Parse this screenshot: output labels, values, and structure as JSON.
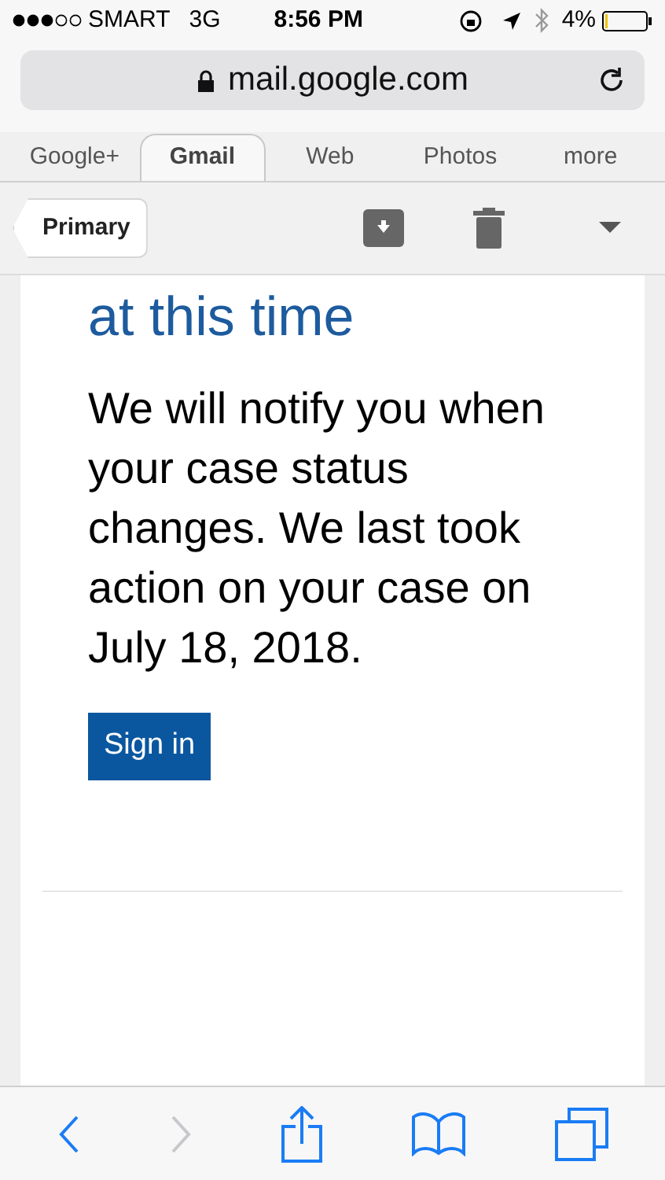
{
  "status_bar": {
    "carrier": "SMART",
    "network": "3G",
    "time": "8:56 PM",
    "battery": "4%"
  },
  "address_bar": {
    "url": "mail.google.com"
  },
  "tabs": [
    {
      "label": "Google+",
      "selected": false
    },
    {
      "label": "Gmail",
      "selected": true
    },
    {
      "label": "Web",
      "selected": false
    },
    {
      "label": "Photos",
      "selected": false
    },
    {
      "label": "more",
      "selected": false
    }
  ],
  "toolbar": {
    "back_label": "Primary"
  },
  "message": {
    "heading": "at this time",
    "body": "We will notify you when your case status changes. We last took action on your case on July 18, 2018.",
    "button": "Sign in"
  },
  "bottom_bar": [
    {
      "kind": "back",
      "disabled": false
    },
    {
      "kind": "forward",
      "disabled": true
    },
    {
      "kind": "share",
      "disabled": false
    },
    {
      "kind": "bookmarks",
      "disabled": false
    },
    {
      "kind": "tabs",
      "disabled": false
    }
  ]
}
